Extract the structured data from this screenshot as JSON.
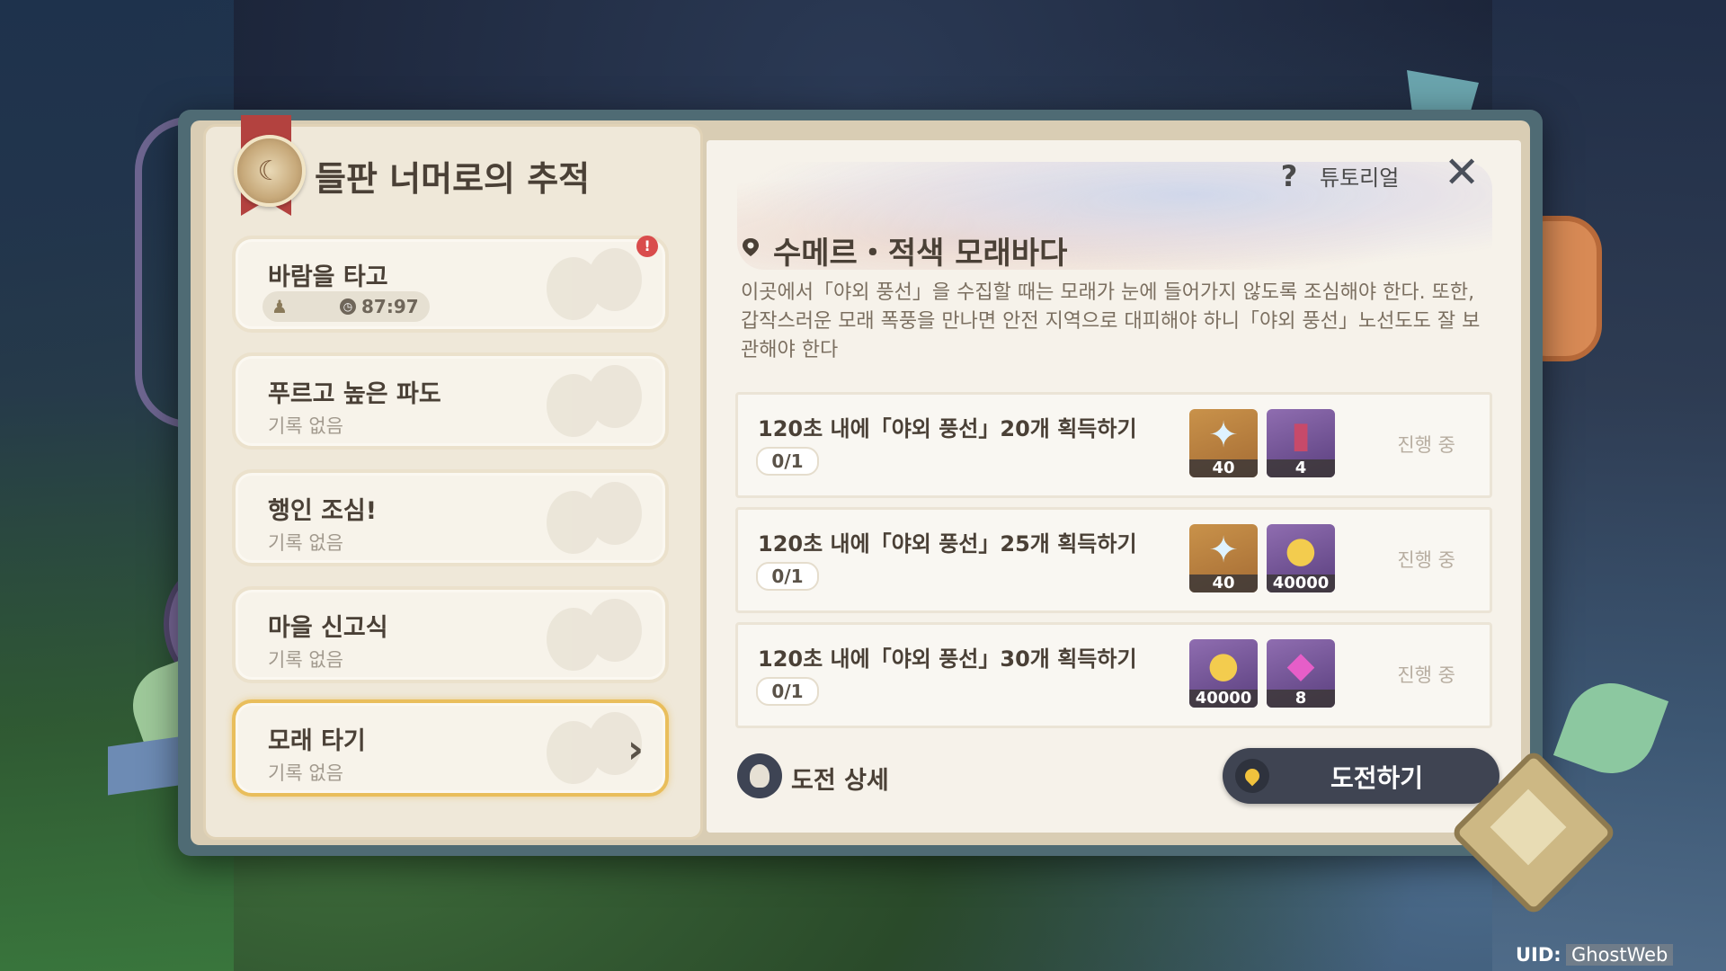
{
  "event": {
    "title": "들판 너머로의 추적"
  },
  "stages": [
    {
      "name": "바람을 타고",
      "record": "87:97",
      "selected": false,
      "alert": "!"
    },
    {
      "name": "푸르고 높은 파도",
      "record": "기록 없음",
      "selected": false
    },
    {
      "name": "행인 조심!",
      "record": "기록 없음",
      "selected": false
    },
    {
      "name": "마을 신고식",
      "record": "기록 없음",
      "selected": false
    },
    {
      "name": "모래 타기",
      "record": "기록 없음",
      "selected": true
    }
  ],
  "header": {
    "tutorial_label": "튜토리얼",
    "tutorial_icon": "question-icon",
    "close_icon": "close-icon"
  },
  "location": {
    "title": "수메르・적색 모래바다",
    "description": "이곳에서「야외 풍선」을 수집할 때는 모래가 눈에 들어가지 않도록 조심해야 한다. 또한, 갑작스러운 모래 폭풍을 만나면 안전 지역으로 대피해야 하니「야외 풍선」노선도도 잘 보관해야 한다"
  },
  "challenges": [
    {
      "text": "120초 내에「야외 풍선」20개 획득하기",
      "progress": "0/1",
      "status": "진행 중",
      "rewards": [
        {
          "icon": "primogem-icon",
          "qty": "40",
          "rarity": "gold"
        },
        {
          "icon": "heros-wit-book-icon",
          "qty": "4",
          "rarity": "purple"
        }
      ]
    },
    {
      "text": "120초 내에「야외 풍선」25개 획득하기",
      "progress": "0/1",
      "status": "진행 중",
      "rewards": [
        {
          "icon": "primogem-icon",
          "qty": "40",
          "rarity": "gold"
        },
        {
          "icon": "mora-coin-icon",
          "qty": "40000",
          "rarity": "purple"
        }
      ]
    },
    {
      "text": "120초 내에「야외 풍선」30개 획득하기",
      "progress": "0/1",
      "status": "진행 중",
      "rewards": [
        {
          "icon": "mora-coin-icon",
          "qty": "40000",
          "rarity": "purple"
        },
        {
          "icon": "crystal-ore-icon",
          "qty": "8",
          "rarity": "purple"
        }
      ]
    }
  ],
  "footer": {
    "detail_label": "도전 상세",
    "start_label": "도전하기"
  },
  "uid": {
    "label": "UID:",
    "value": "GhostWeb"
  },
  "colors": {
    "accent_gold": "#e9be5c",
    "button_dark": "#3f4452",
    "alert_red": "#d94c4c",
    "pin_yellow": "#f1c23d"
  }
}
